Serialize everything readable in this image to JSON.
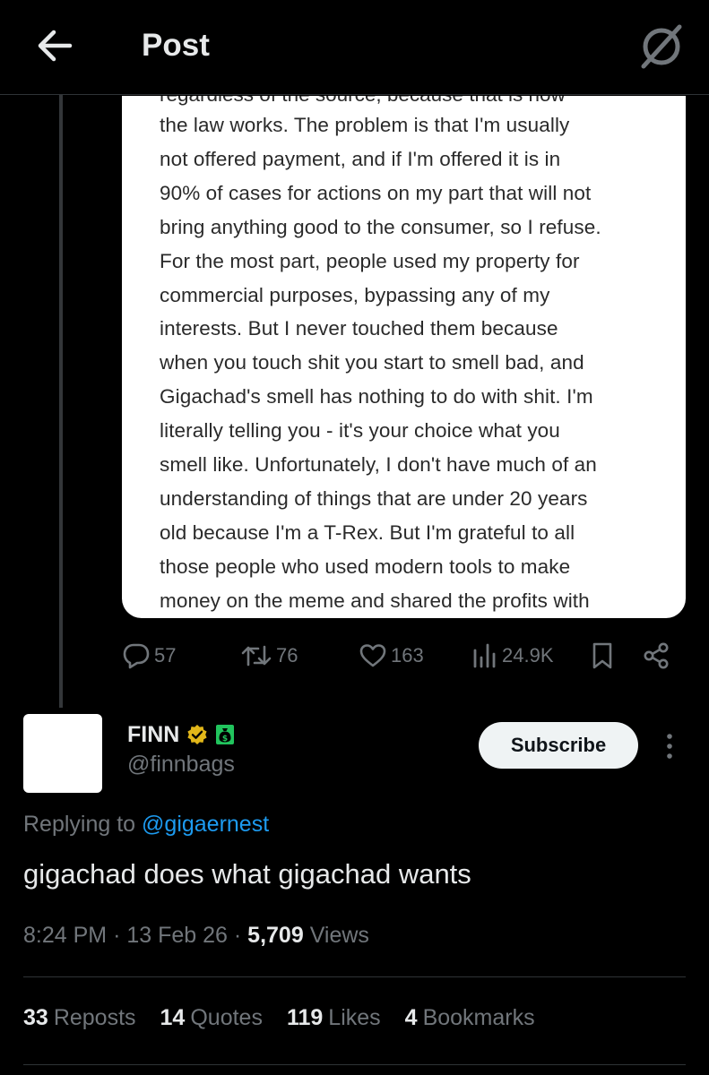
{
  "header": {
    "title": "Post"
  },
  "quoted_card": {
    "cut_line": "regardless of the source, because that is how",
    "lines": [
      "the law works. The problem is that I'm usually",
      "not offered payment, and if I'm offered it is in",
      "90% of cases for actions on my part that will not",
      "bring anything good to the consumer, so I refuse.",
      "For the most part, people used my property for",
      "commercial purposes, bypassing any of my",
      "interests. But I never touched them because",
      "when you touch shit you start to smell bad, and",
      "Gigachad's smell has nothing to do with shit. I'm",
      "literally telling you - it's your choice what you",
      "smell like. Unfortunately, I don't have much of an",
      "understanding of things that are under 20 years",
      "old because I'm a T-Rex. But I'm grateful to all",
      "those people who used modern tools to make",
      "money on the meme and shared the profits with"
    ]
  },
  "parent_actions": {
    "replies": "57",
    "reposts": "76",
    "likes": "163",
    "views": "24.9K"
  },
  "reply": {
    "name": "FINN",
    "handle": "@finnbags",
    "subscribe_label": "Subscribe",
    "replying_prefix": "Replying to",
    "replying_to": "@gigaernest",
    "text": "gigachad does what gigachad wants",
    "time": "8:24 PM",
    "date": "13 Feb 26",
    "views_count": "5,709",
    "views_label": "Views"
  },
  "stats": [
    {
      "num": "33",
      "label": "Reposts"
    },
    {
      "num": "14",
      "label": "Quotes"
    },
    {
      "num": "119",
      "label": "Likes"
    },
    {
      "num": "4",
      "label": "Bookmarks"
    }
  ],
  "colors": {
    "accent": "#1d9bf0",
    "verified": "#e2b719",
    "money": "#21c45d",
    "muted": "#71767b"
  }
}
